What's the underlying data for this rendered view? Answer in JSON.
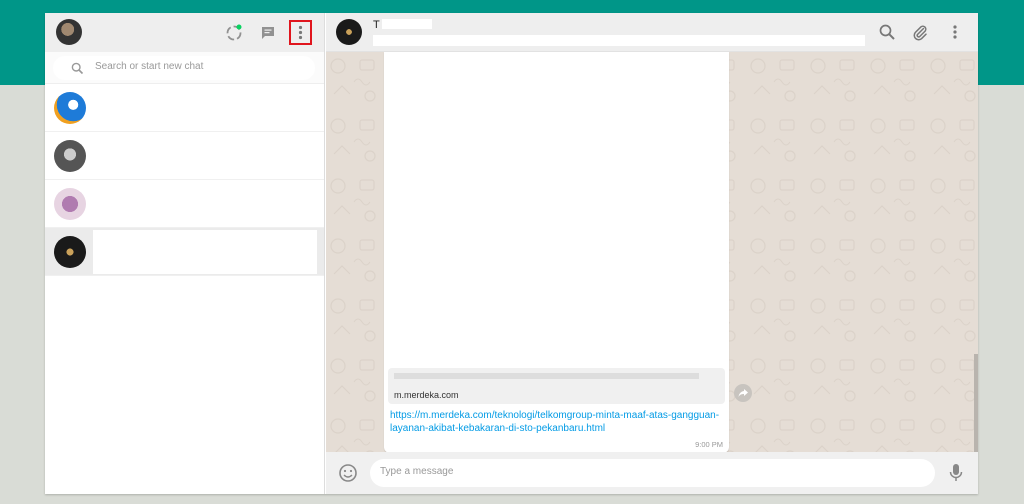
{
  "sidebar": {
    "search": {
      "placeholder": "Search or start new chat"
    },
    "chats": [
      {
        "avatar": "eagle-logo-avatar"
      },
      {
        "avatar": "grayscale-photo-avatar"
      },
      {
        "avatar": "group-photo-avatar"
      },
      {
        "avatar": "dark-photo-avatar",
        "selected": true
      }
    ]
  },
  "conversation": {
    "header": {
      "name_partial": "T"
    },
    "message": {
      "preview_domain": "m.merdeka.com",
      "link": "https://m.merdeka.com/teknologi/telkomgroup-minta-maaf-atas-gangguan-layanan-akibat-kebakaran-di-sto-pekanbaru.html",
      "time": "9:00 PM"
    },
    "compose": {
      "placeholder": "Type a message"
    }
  },
  "colors": {
    "top_band": "#009688",
    "highlight_box": "#e0151d",
    "link": "#039be5",
    "chat_background": "#e5ddd5"
  }
}
